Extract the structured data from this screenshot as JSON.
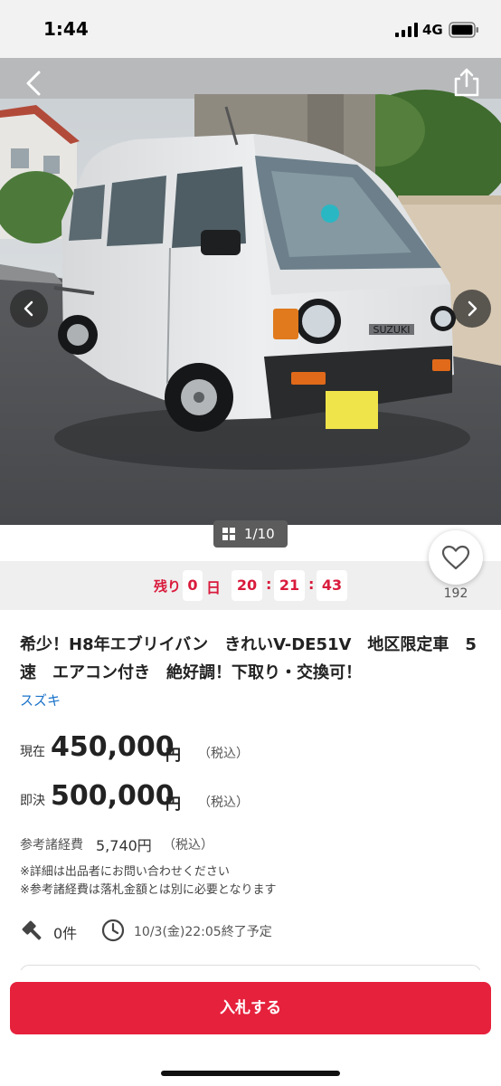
{
  "status_bar": {
    "time": "1:44",
    "network": "4G"
  },
  "gallery": {
    "counter": "1/10",
    "plate_text": "SUZUKI"
  },
  "countdown": {
    "label": "残り",
    "days": "0",
    "day_unit": "日",
    "hours": "20",
    "minutes": "21",
    "seconds": "43"
  },
  "watch": {
    "count": "192"
  },
  "item": {
    "title": "希少！H8年エブリイバン　きれいV-DE51V　地区限定車　5速　エアコン付き　絶好調！下取り・交換可！",
    "brand": "スズキ"
  },
  "prices": {
    "current_label": "現在",
    "current_value": "450,000",
    "buyout_label": "即決",
    "buyout_value": "500,000",
    "unit": "円",
    "tax": "（税込）"
  },
  "fees": {
    "label": "参考諸経費",
    "value": "5,740円",
    "tax": "（税込）",
    "notes": [
      "※詳細は出品者にお問い合わせください",
      "※参考諸経費は落札金額とは別に必要となります"
    ]
  },
  "meta": {
    "bids": "0件",
    "end_time": "10/3(金)22:05終了予定"
  },
  "actions": {
    "bid_label": "入札する"
  },
  "colors": {
    "accent": "#e6213c",
    "countdown": "#d91b3c",
    "link": "#1a73c9"
  }
}
